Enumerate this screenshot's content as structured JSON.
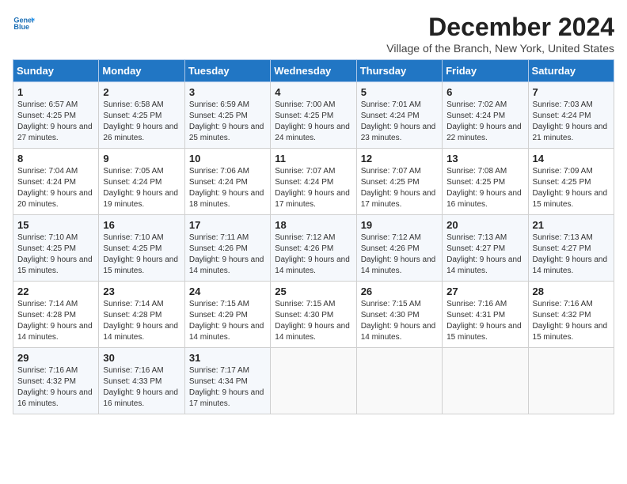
{
  "logo": {
    "line1": "General",
    "line2": "Blue"
  },
  "title": "December 2024",
  "subtitle": "Village of the Branch, New York, United States",
  "weekdays": [
    "Sunday",
    "Monday",
    "Tuesday",
    "Wednesday",
    "Thursday",
    "Friday",
    "Saturday"
  ],
  "weeks": [
    [
      {
        "day": "1",
        "info": "Sunrise: 6:57 AM\nSunset: 4:25 PM\nDaylight: 9 hours and 27 minutes."
      },
      {
        "day": "2",
        "info": "Sunrise: 6:58 AM\nSunset: 4:25 PM\nDaylight: 9 hours and 26 minutes."
      },
      {
        "day": "3",
        "info": "Sunrise: 6:59 AM\nSunset: 4:25 PM\nDaylight: 9 hours and 25 minutes."
      },
      {
        "day": "4",
        "info": "Sunrise: 7:00 AM\nSunset: 4:25 PM\nDaylight: 9 hours and 24 minutes."
      },
      {
        "day": "5",
        "info": "Sunrise: 7:01 AM\nSunset: 4:24 PM\nDaylight: 9 hours and 23 minutes."
      },
      {
        "day": "6",
        "info": "Sunrise: 7:02 AM\nSunset: 4:24 PM\nDaylight: 9 hours and 22 minutes."
      },
      {
        "day": "7",
        "info": "Sunrise: 7:03 AM\nSunset: 4:24 PM\nDaylight: 9 hours and 21 minutes."
      }
    ],
    [
      {
        "day": "8",
        "info": "Sunrise: 7:04 AM\nSunset: 4:24 PM\nDaylight: 9 hours and 20 minutes."
      },
      {
        "day": "9",
        "info": "Sunrise: 7:05 AM\nSunset: 4:24 PM\nDaylight: 9 hours and 19 minutes."
      },
      {
        "day": "10",
        "info": "Sunrise: 7:06 AM\nSunset: 4:24 PM\nDaylight: 9 hours and 18 minutes."
      },
      {
        "day": "11",
        "info": "Sunrise: 7:07 AM\nSunset: 4:24 PM\nDaylight: 9 hours and 17 minutes."
      },
      {
        "day": "12",
        "info": "Sunrise: 7:07 AM\nSunset: 4:25 PM\nDaylight: 9 hours and 17 minutes."
      },
      {
        "day": "13",
        "info": "Sunrise: 7:08 AM\nSunset: 4:25 PM\nDaylight: 9 hours and 16 minutes."
      },
      {
        "day": "14",
        "info": "Sunrise: 7:09 AM\nSunset: 4:25 PM\nDaylight: 9 hours and 15 minutes."
      }
    ],
    [
      {
        "day": "15",
        "info": "Sunrise: 7:10 AM\nSunset: 4:25 PM\nDaylight: 9 hours and 15 minutes."
      },
      {
        "day": "16",
        "info": "Sunrise: 7:10 AM\nSunset: 4:25 PM\nDaylight: 9 hours and 15 minutes."
      },
      {
        "day": "17",
        "info": "Sunrise: 7:11 AM\nSunset: 4:26 PM\nDaylight: 9 hours and 14 minutes."
      },
      {
        "day": "18",
        "info": "Sunrise: 7:12 AM\nSunset: 4:26 PM\nDaylight: 9 hours and 14 minutes."
      },
      {
        "day": "19",
        "info": "Sunrise: 7:12 AM\nSunset: 4:26 PM\nDaylight: 9 hours and 14 minutes."
      },
      {
        "day": "20",
        "info": "Sunrise: 7:13 AM\nSunset: 4:27 PM\nDaylight: 9 hours and 14 minutes."
      },
      {
        "day": "21",
        "info": "Sunrise: 7:13 AM\nSunset: 4:27 PM\nDaylight: 9 hours and 14 minutes."
      }
    ],
    [
      {
        "day": "22",
        "info": "Sunrise: 7:14 AM\nSunset: 4:28 PM\nDaylight: 9 hours and 14 minutes."
      },
      {
        "day": "23",
        "info": "Sunrise: 7:14 AM\nSunset: 4:28 PM\nDaylight: 9 hours and 14 minutes."
      },
      {
        "day": "24",
        "info": "Sunrise: 7:15 AM\nSunset: 4:29 PM\nDaylight: 9 hours and 14 minutes."
      },
      {
        "day": "25",
        "info": "Sunrise: 7:15 AM\nSunset: 4:30 PM\nDaylight: 9 hours and 14 minutes."
      },
      {
        "day": "26",
        "info": "Sunrise: 7:15 AM\nSunset: 4:30 PM\nDaylight: 9 hours and 14 minutes."
      },
      {
        "day": "27",
        "info": "Sunrise: 7:16 AM\nSunset: 4:31 PM\nDaylight: 9 hours and 15 minutes."
      },
      {
        "day": "28",
        "info": "Sunrise: 7:16 AM\nSunset: 4:32 PM\nDaylight: 9 hours and 15 minutes."
      }
    ],
    [
      {
        "day": "29",
        "info": "Sunrise: 7:16 AM\nSunset: 4:32 PM\nDaylight: 9 hours and 16 minutes."
      },
      {
        "day": "30",
        "info": "Sunrise: 7:16 AM\nSunset: 4:33 PM\nDaylight: 9 hours and 16 minutes."
      },
      {
        "day": "31",
        "info": "Sunrise: 7:17 AM\nSunset: 4:34 PM\nDaylight: 9 hours and 17 minutes."
      },
      null,
      null,
      null,
      null
    ]
  ]
}
